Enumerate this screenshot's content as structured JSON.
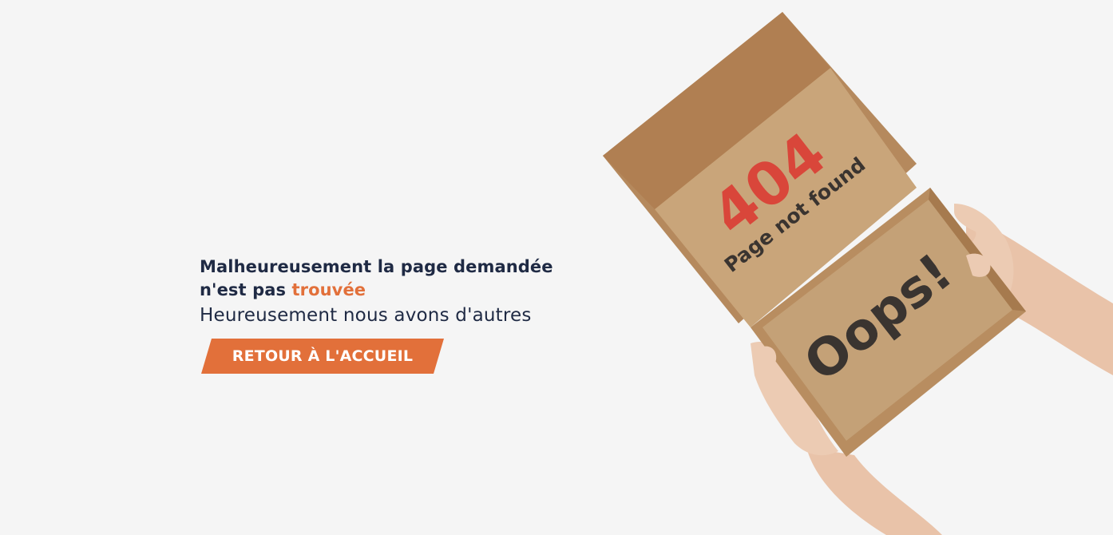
{
  "message": {
    "headline_part1": "Malheureusement la page demandée",
    "headline_part2": "n'est pas ",
    "headline_accent": "trouvée",
    "subline": "Heureusement nous avons d'autres"
  },
  "cta": {
    "label": "RETOUR À L'ACCUEIL"
  },
  "box": {
    "code": "404",
    "lid_text": "Page not found",
    "bottom_text": "Oops!"
  },
  "colors": {
    "background": "#f5f5f5",
    "text": "#1f2a44",
    "accent": "#e2703a",
    "cardboard": "#c9a57a",
    "code_red": "#d9463a"
  }
}
